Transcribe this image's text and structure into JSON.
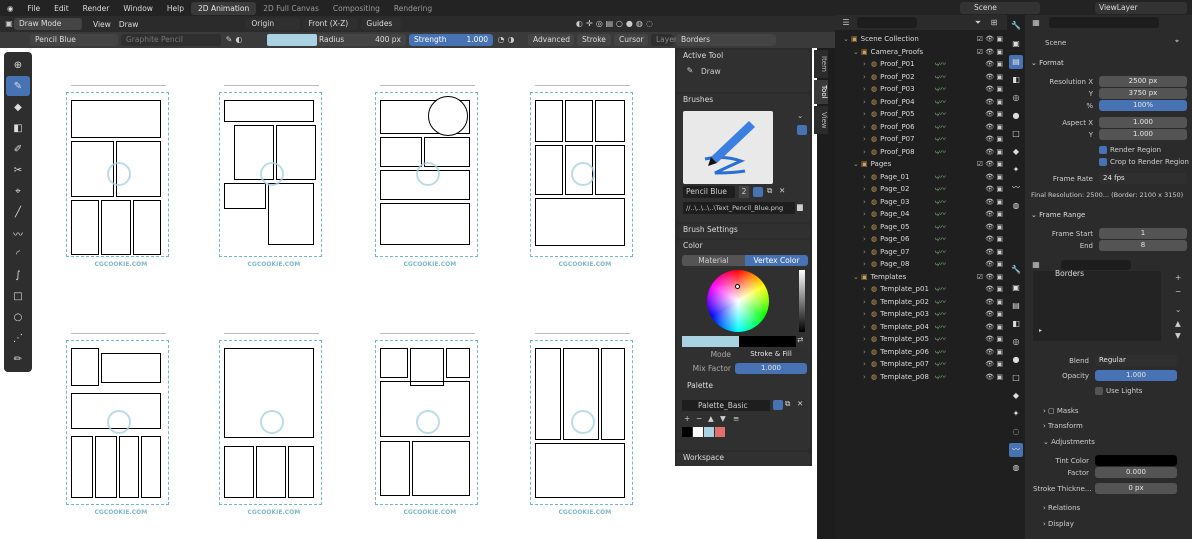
{
  "menu": [
    "File",
    "Edit",
    "Render",
    "Window",
    "Help"
  ],
  "workspaces": [
    {
      "label": "2D Animation",
      "active": true
    },
    {
      "label": "2D Full Canvas",
      "active": false
    },
    {
      "label": "Compositing",
      "active": false
    },
    {
      "label": "Rendering",
      "active": false
    }
  ],
  "scene_label": "Scene",
  "viewlayer_label": "ViewLayer",
  "header": {
    "mode": "Draw Mode",
    "view": "View",
    "draw": "Draw",
    "origin": "Origin",
    "orientation": "Front (X-Z)",
    "guides": "Guides"
  },
  "toolsettings": {
    "brush": "Pencil Blue",
    "material": "Graphite Pencil",
    "radius_label": "Radius",
    "radius_value": "400 px",
    "strength_label": "Strength",
    "strength_value": "1.000",
    "advanced": "Advanced",
    "stroke": "Stroke",
    "cursor": "Cursor",
    "layer": "Layer",
    "layer_value": "Borders",
    "color_swatch": "#a9d3e3"
  },
  "watermark": "CGCOOKIE.COM",
  "npanel": {
    "tabs": [
      "Item",
      "Tool",
      "View"
    ],
    "active_tool_title": "Active Tool",
    "active_tool": "Draw",
    "brushes_title": "Brushes",
    "brush_name": "Pencil Blue",
    "brush_users": "2",
    "brush_path": "//..\\..\\..\\..\\Text_Pencil_Blue.png",
    "brush_settings_title": "Brush Settings",
    "color_title": "Color",
    "color_tabs": [
      "Material",
      "Vertex Color"
    ],
    "mode_label": "Mode",
    "mode_value": "Stroke & Fill",
    "mix_label": "Mix Factor",
    "mix_value": "1.000",
    "palette_title": "Palette",
    "palette_name": "Palette_Basic",
    "palette_colors": [
      "#000000",
      "#ffffff",
      "#a9d3e3",
      "#e07070"
    ],
    "workspace_title": "Workspace"
  },
  "outliner": {
    "root": "Scene Collection",
    "groups": [
      {
        "name": "Camera_Proofs",
        "items": [
          "Proof_P01",
          "Proof_P02",
          "Proof_P03",
          "Proof_P04",
          "Proof_P05",
          "Proof_P06",
          "Proof_P07",
          "Proof_P08"
        ]
      },
      {
        "name": "Pages",
        "items": [
          "Page_01",
          "Page_02",
          "Page_03",
          "Page_04",
          "Page_05",
          "Page_06",
          "Page_07",
          "Page_08"
        ]
      },
      {
        "name": "Templates",
        "items": [
          "Template_p01",
          "Template_p02",
          "Template_p03",
          "Template_p04",
          "Template_p05",
          "Template_p06",
          "Template_p07",
          "Template_p08"
        ]
      }
    ]
  },
  "props": {
    "scene": "Scene",
    "format_title": "Format",
    "res_x_label": "Resolution X",
    "res_x": "2500 px",
    "res_y_label": "Y",
    "res_y": "3750 px",
    "res_pct_label": "%",
    "res_pct": "100%",
    "aspect_x_label": "Aspect X",
    "aspect_x": "1.000",
    "aspect_y_label": "Y",
    "aspect_y": "1.000",
    "render_region": "Render Region",
    "crop_region": "Crop to Render Region",
    "frame_rate_label": "Frame Rate",
    "frame_rate": "24 fps",
    "final_res": "Final Resolution: 2500... (Border: 2100 x 3150)",
    "frame_range_title": "Frame Range",
    "frame_start_label": "Frame Start",
    "frame_start": "1",
    "end_label": "End",
    "end": "8"
  },
  "layers": {
    "layer_name": "Borders",
    "blend_label": "Blend",
    "blend": "Regular",
    "opacity_label": "Opacity",
    "opacity": "1.000",
    "use_lights": "Use Lights",
    "masks": "Masks",
    "transform": "Transform",
    "adjustments": "Adjustments",
    "tint_color_label": "Tint Color",
    "factor_label": "Factor",
    "factor": "0.000",
    "stroke_thickness_label": "Stroke Thickne...",
    "stroke_thickness": "0 px",
    "relations": "Relations",
    "display": "Display"
  }
}
